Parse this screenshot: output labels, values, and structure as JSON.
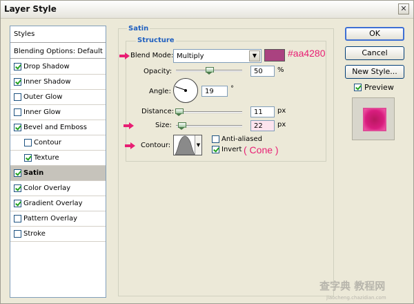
{
  "window": {
    "title": "Layer Style"
  },
  "list": {
    "header": "Styles",
    "blending": "Blending Options: Default",
    "items": [
      {
        "label": "Drop Shadow",
        "checked": true,
        "indent": false,
        "selected": false
      },
      {
        "label": "Inner Shadow",
        "checked": true,
        "indent": false,
        "selected": false
      },
      {
        "label": "Outer Glow",
        "checked": false,
        "indent": false,
        "selected": false
      },
      {
        "label": "Inner Glow",
        "checked": false,
        "indent": false,
        "selected": false
      },
      {
        "label": "Bevel and Emboss",
        "checked": true,
        "indent": false,
        "selected": false
      },
      {
        "label": "Contour",
        "checked": false,
        "indent": true,
        "selected": false
      },
      {
        "label": "Texture",
        "checked": true,
        "indent": true,
        "selected": false
      },
      {
        "label": "Satin",
        "checked": true,
        "indent": false,
        "selected": true
      },
      {
        "label": "Color Overlay",
        "checked": true,
        "indent": false,
        "selected": false
      },
      {
        "label": "Gradient Overlay",
        "checked": true,
        "indent": false,
        "selected": false
      },
      {
        "label": "Pattern Overlay",
        "checked": false,
        "indent": false,
        "selected": false
      },
      {
        "label": "Stroke",
        "checked": false,
        "indent": false,
        "selected": false
      }
    ]
  },
  "satin": {
    "group_title": "Satin",
    "structure_title": "Structure",
    "blend_mode_label": "Blend Mode:",
    "blend_mode_value": "Multiply",
    "color_hex": "#aa4280",
    "color_annotation": "#aa4280",
    "opacity_label": "Opacity:",
    "opacity_value": "50",
    "opacity_unit": "%",
    "angle_label": "Angle:",
    "angle_value": "19",
    "angle_unit": "°",
    "distance_label": "Distance:",
    "distance_value": "11",
    "distance_unit": "px",
    "size_label": "Size:",
    "size_value": "22",
    "size_unit": "px",
    "contour_label": "Contour:",
    "anti_aliased_label": "Anti-aliased",
    "anti_aliased_checked": false,
    "invert_label": "Invert",
    "invert_checked": true,
    "cone_annotation": "( Cone )"
  },
  "buttons": {
    "ok": "OK",
    "cancel": "Cancel",
    "new_style": "New Style...",
    "preview": "Preview",
    "preview_checked": true
  },
  "watermark": {
    "main": "查字典 教程网",
    "sub": "jiaocheng.chazidian.com"
  },
  "colors": {
    "accent_pink": "#e81e73",
    "group_title_blue": "#1f5fbf",
    "preview_magenta": "#d81d7e"
  }
}
